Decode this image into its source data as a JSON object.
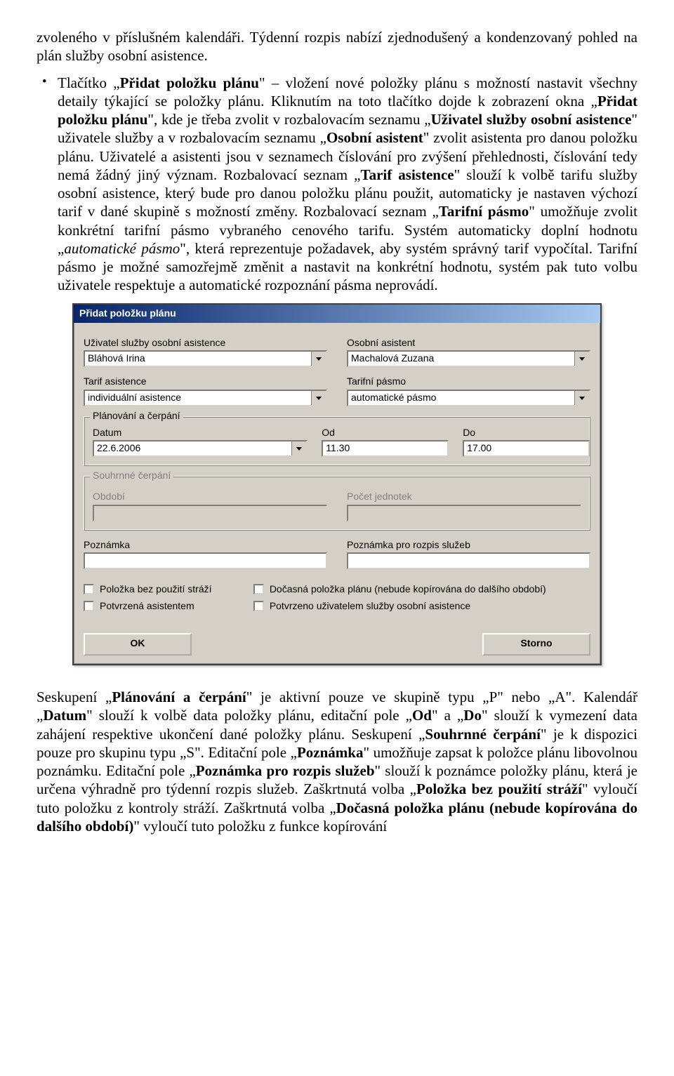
{
  "para1_a": "zvoleného v příslušném kalendáři. Týdenní rozpis nabízí zjednodušený a kondenzovaný pohled na plán služby osobní asistence.",
  "bullet_pre": "Tlačítko „",
  "bullet_b1": "Přidat položku plánu",
  "bullet_mid1": "\" – vložení nové položky plánu s možností nastavit všechny detaily týkající se položky plánu. Kliknutím na toto tlačítko dojde k zobrazení okna „",
  "bullet_b2": "Přidat položku plánu",
  "bullet_mid2": "\", kde je třeba zvolit v rozbalovacím seznamu „",
  "bullet_b3": "Uživatel služby osobní asistence",
  "bullet_mid3": "\" uživatele služby a v rozbalovacím seznamu „",
  "bullet_b4": "Osobní asistent",
  "bullet_mid4": "\" zvolit asistenta pro danou položku plánu. Uživatelé a asistenti jsou v seznamech číslování pro zvýšení přehlednosti, číslování tedy nemá žádný jiný význam. Rozbalovací seznam „",
  "bullet_b5": "Tarif asistence",
  "bullet_mid5": "\" slouží k volbě tarifu služby osobní asistence, který bude pro danou položku plánu použit, automaticky je nastaven výchozí tarif v dané skupině s možností změny. Rozbalovací seznam „",
  "bullet_b6": "Tarifní pásmo",
  "bullet_mid6": "\" umožňuje zvolit konkrétní tarifní pásmo vybraného cenového tarifu. Systém automaticky doplní hodnotu „",
  "bullet_i1": "automatické pásmo",
  "bullet_mid7": "\", která reprezentuje požadavek, aby systém správný tarif vypočítal. Tarifní pásmo je možné samozřejmě změnit a nastavit na konkrétní hodnotu, systém pak tuto volbu uživatele respektuje a automatické rozpoznání pásma neprovádí.",
  "dlg": {
    "title": "Přidat položku plánu",
    "lbl_user": "Uživatel služby osobní asistence",
    "val_user": "Bláhová Irina",
    "lbl_asst": "Osobní asistent",
    "val_asst": "Machalová Zuzana",
    "lbl_tarif": "Tarif asistence",
    "val_tarif": "individuální asistence",
    "lbl_pasmo": "Tarifní pásmo",
    "val_pasmo": "automatické pásmo",
    "grp_plan": "Plánování a čerpání",
    "lbl_date": "Datum",
    "val_date": "22.6.2006",
    "lbl_od": "Od",
    "val_od": "11.30",
    "lbl_do": "Do",
    "val_do": "17.00",
    "grp_souhrn": "Souhrnné čerpání",
    "lbl_obdobi": "Období",
    "lbl_jedn": "Počet jednotek",
    "lbl_pozn": "Poznámka",
    "lbl_pozn2": "Poznámka pro rozpis služeb",
    "chk1": "Položka bez použití stráží",
    "chk2": "Dočasná položka plánu (nebude kopírována do dalšího období)",
    "chk3": "Potvrzená asistentem",
    "chk4": "Potvrzeno uživatelem služby osobní asistence",
    "btn_ok": "OK",
    "btn_cancel": "Storno"
  },
  "para2_pre": "Seskupení „",
  "para2_b1": "Plánování a čerpání",
  "para2_m1": "\" je aktivní pouze ve skupině typu „P\" nebo „A\". Kalendář „",
  "para2_b2": "Datum",
  "para2_m2": "\" slouží k volbě data položky plánu, editační pole „",
  "para2_b3": "Od",
  "para2_m3": "\" a „",
  "para2_b4": "Do",
  "para2_m4": "\" slouží k vymezení data zahájení respektive ukončení dané položky plánu. Seskupení „",
  "para2_b5": "Souhrnné čerpání",
  "para2_m5": "\" je k dispozici pouze pro skupinu typu „S\". Editační pole „",
  "para2_b6": "Poznámka",
  "para2_m6": "\" umožňuje zapsat k položce plánu libovolnou poznámku. Editační pole „",
  "para2_b7": "Poznámka pro rozpis služeb",
  "para2_m7": "\" slouží k poznámce položky plánu, která je určena výhradně pro týdenní rozpis služeb. Zaškrtnutá volba „",
  "para2_b8": "Položka bez použití stráží",
  "para2_m8": "\" vyloučí tuto položku z kontroly stráží. Zaškrtnutá volba „",
  "para2_b9": "Dočasná položka plánu (nebude kopírována do dalšího období)",
  "para2_m9": "\" vyloučí tuto položku z funkce kopírování"
}
